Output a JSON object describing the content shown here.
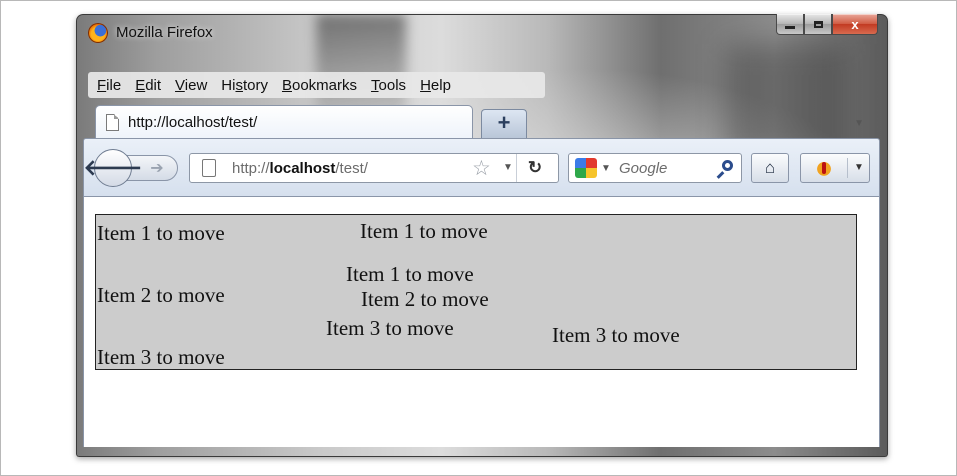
{
  "window": {
    "title": "Mozilla Firefox",
    "close_glyph": "x"
  },
  "menubar": {
    "items": [
      {
        "accel": "F",
        "rest": "ile"
      },
      {
        "accel": "E",
        "rest": "dit"
      },
      {
        "accel": "V",
        "rest": "iew"
      },
      {
        "pre": "Hi",
        "accel": "s",
        "rest": "tory"
      },
      {
        "accel": "B",
        "rest": "ookmarks"
      },
      {
        "accel": "T",
        "rest": "ools"
      },
      {
        "accel": "H",
        "rest": "elp"
      }
    ]
  },
  "tab": {
    "title": "http://localhost/test/",
    "new_tab_label": "+"
  },
  "navbar": {
    "url_prefix": "http://",
    "url_host": "localhost",
    "url_path": "/test/",
    "search_placeholder": "Google",
    "icons": [
      "back-arrow-icon",
      "forward-arrow-icon",
      "page-icon",
      "star-icon",
      "reload-icon",
      "google-icon",
      "magnifier-icon",
      "home-icon",
      "bug-icon"
    ]
  },
  "content": {
    "box_background": "#cccccc",
    "column1": [
      "Item 1 to move",
      "Item 2 to move",
      "Item 3 to move"
    ],
    "moved": [
      "Item 1 to move",
      "Item 1 to move",
      "Item 2 to move",
      "Item 3 to move",
      "Item 3 to move"
    ]
  }
}
